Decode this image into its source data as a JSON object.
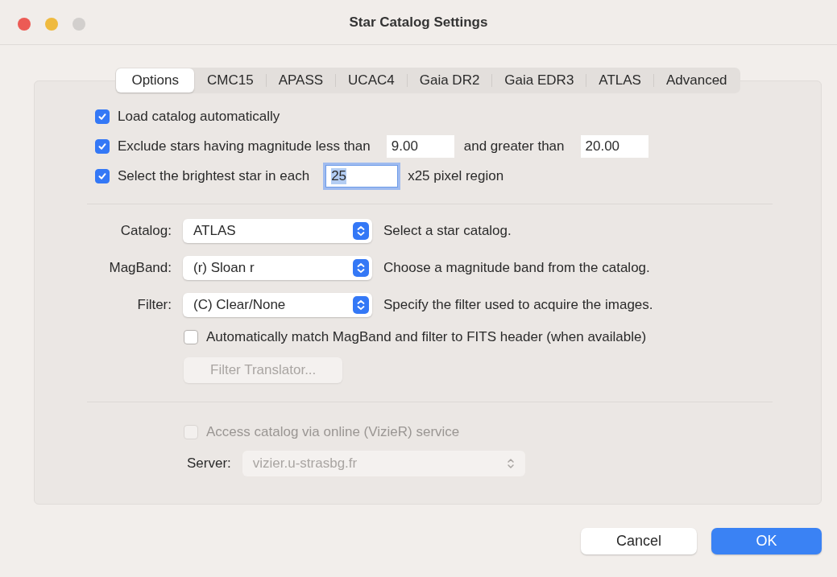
{
  "window": {
    "title": "Star Catalog Settings"
  },
  "tabs": [
    {
      "label": "Options",
      "selected": true
    },
    {
      "label": "CMC15",
      "selected": false
    },
    {
      "label": "APASS",
      "selected": false
    },
    {
      "label": "UCAC4",
      "selected": false
    },
    {
      "label": "Gaia DR2",
      "selected": false
    },
    {
      "label": "Gaia EDR3",
      "selected": false
    },
    {
      "label": "ATLAS",
      "selected": false
    },
    {
      "label": "Advanced",
      "selected": false
    }
  ],
  "load_catalog": {
    "label": "Load catalog automatically",
    "checked": true
  },
  "exclude": {
    "label": "Exclude stars having magnitude less than",
    "checked": true,
    "min": "9.00",
    "middle": "and greater than",
    "max": "20.00"
  },
  "brightest": {
    "label": "Select the brightest star in each",
    "checked": true,
    "value": "25",
    "focused": true,
    "suffix": "x25 pixel region"
  },
  "popups": [
    {
      "label": "Catalog:",
      "value": "ATLAS",
      "hint": "Select a star catalog."
    },
    {
      "label": "MagBand:",
      "value": "(r) Sloan r",
      "hint": "Choose a magnitude band from the catalog."
    },
    {
      "label": "Filter:",
      "value": "(C) Clear/None",
      "hint": "Specify the filter used to acquire the images."
    }
  ],
  "auto_match": {
    "label": "Automatically match MagBand and filter to FITS header (when available)",
    "checked": false
  },
  "filter_translator": {
    "label": "Filter Translator...",
    "disabled": true
  },
  "online": {
    "label": "Access catalog via online (VizieR) service",
    "checked": false,
    "disabled": true
  },
  "server": {
    "label": "Server:",
    "value": "vizier.u-strasbg.fr",
    "disabled": true
  },
  "buttons": [
    {
      "label": "Cancel",
      "default": false
    },
    {
      "label": "OK",
      "default": true
    }
  ]
}
